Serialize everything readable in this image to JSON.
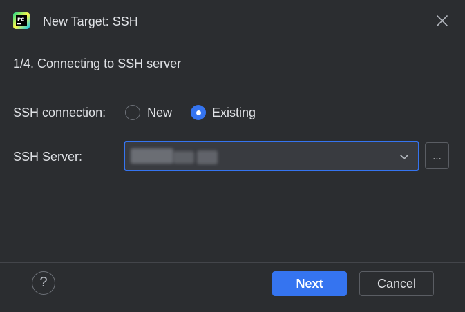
{
  "window": {
    "title": "New Target: SSH",
    "app_icon": "pycharm-logo-icon",
    "close_icon": "close-icon"
  },
  "step": {
    "text": "1/4. Connecting to SSH server"
  },
  "form": {
    "connection_label": "SSH connection:",
    "options": [
      {
        "label": "New",
        "selected": false
      },
      {
        "label": "Existing",
        "selected": true
      }
    ],
    "server_label": "SSH Server:",
    "server_value": "",
    "server_value_redacted": true,
    "dropdown_icon": "chevron-down-icon",
    "browse_label": "..."
  },
  "footer": {
    "help_label": "?",
    "next_label": "Next",
    "cancel_label": "Cancel"
  },
  "colors": {
    "background": "#2b2d30",
    "accent": "#3574f0",
    "text": "#dfe1e5",
    "field_background": "#393b40"
  }
}
